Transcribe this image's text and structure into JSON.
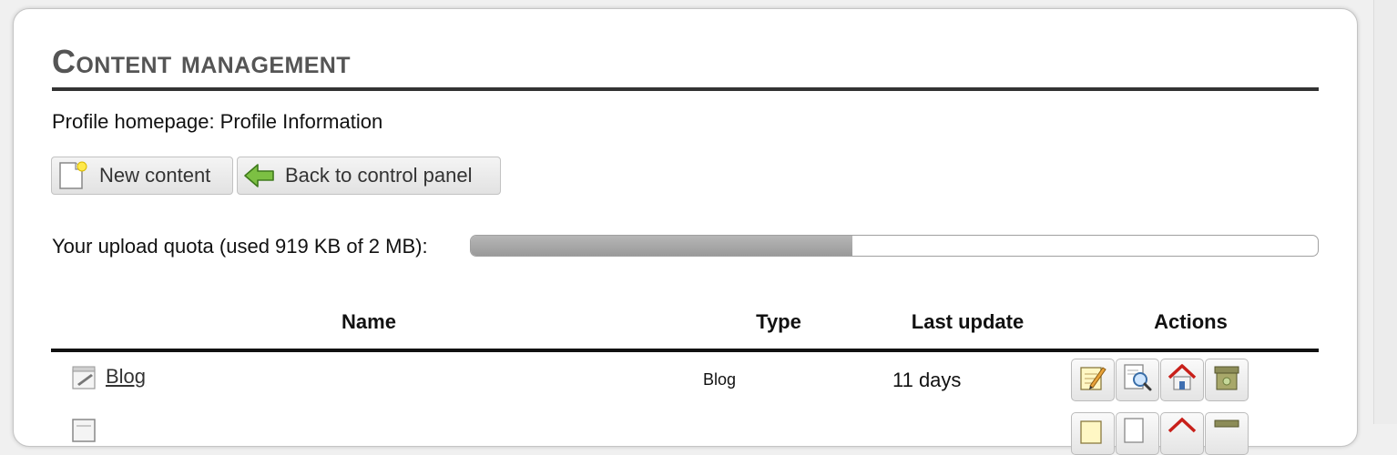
{
  "page": {
    "title": "Content management",
    "profile_line": "Profile homepage: Profile Information"
  },
  "toolbar": {
    "new_content_label": "New content",
    "new_content_icon": "new-document-icon",
    "back_label": "Back to control panel",
    "back_icon": "green-arrow-left-icon"
  },
  "quota": {
    "label": "Your upload quota (used 919 KB of 2 MB):",
    "used_fraction": 0.45
  },
  "table": {
    "columns": {
      "name": "Name",
      "type": "Type",
      "last_update": "Last update",
      "actions": "Actions"
    },
    "rows": [
      {
        "icon": "blog-icon",
        "name": "Blog",
        "type": "Blog",
        "last_update": "11 days",
        "actions": [
          "edit-icon",
          "preview-icon",
          "home-icon",
          "archive-icon"
        ]
      },
      {
        "icon": "document-icon",
        "name": "",
        "type": "",
        "last_update": "",
        "actions": [
          "edit-icon",
          "preview-icon",
          "home-icon",
          "archive-icon"
        ]
      }
    ]
  }
}
